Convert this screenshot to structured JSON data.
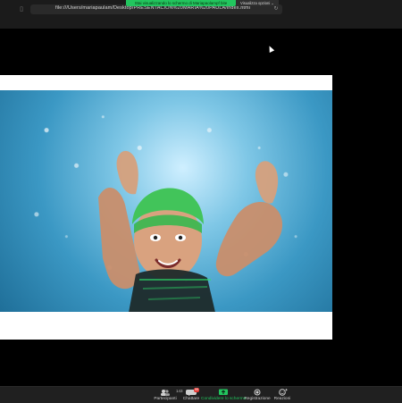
{
  "browser": {
    "address": "file:///Users/mariapaulam/Desktop/PRESENTACION%20MARIA%20PAULA/index.html"
  },
  "screen_share": {
    "banner": "Stai visualizzando lo schermo di Mariapaolampf bite",
    "view_options": "Visualizza opzioni ⌄"
  },
  "slide": {
    "image_alt": "child underwater giving thumbs up"
  },
  "toolbar": {
    "participants_label": "Partecipanti",
    "participants_count": "143",
    "chat_label": "Chattare",
    "chat_badge": "99",
    "share_label": "Condividere lo schermo",
    "record_label": "Registrazione",
    "reactions_label": "Reazioni"
  },
  "colors": {
    "share_green": "#22c55e",
    "toolbar_bg": "#202020",
    "badge_red": "#e53935"
  }
}
